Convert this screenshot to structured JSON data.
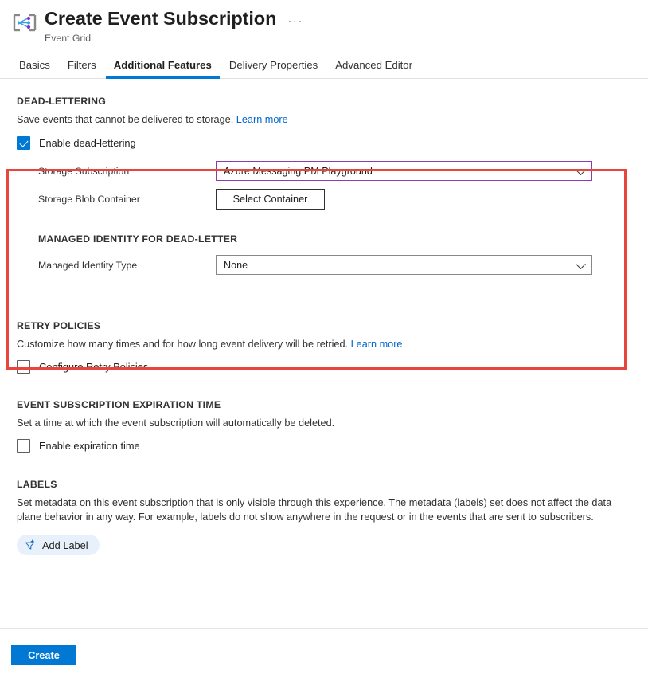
{
  "header": {
    "icon": "event-grid-icon",
    "title": "Create Event Subscription",
    "subtitle": "Event Grid",
    "more_menu": "···"
  },
  "tabs": [
    {
      "label": "Basics",
      "active": false
    },
    {
      "label": "Filters",
      "active": false
    },
    {
      "label": "Additional Features",
      "active": true
    },
    {
      "label": "Delivery Properties",
      "active": false
    },
    {
      "label": "Advanced Editor",
      "active": false
    }
  ],
  "highlight": {
    "color": "#e8453c"
  },
  "dead_lettering": {
    "title": "DEAD-LETTERING",
    "description": "Save events that cannot be delivered to storage.",
    "learn_more": "Learn more",
    "enable_checkbox": {
      "label": "Enable dead-lettering",
      "checked": true
    },
    "storage_subscription": {
      "label": "Storage Subscription",
      "value": "Azure Messaging PM Playground",
      "border_color": "#8e3bb0"
    },
    "storage_blob_container": {
      "label": "Storage Blob Container",
      "button_label": "Select Container"
    },
    "managed_identity": {
      "title": "MANAGED IDENTITY FOR DEAD-LETTER",
      "label": "Managed Identity Type",
      "value": "None"
    }
  },
  "retry_policies": {
    "title": "RETRY POLICIES",
    "description": "Customize how many times and for how long event delivery will be retried.",
    "learn_more": "Learn more",
    "checkbox": {
      "label": "Configure Retry Policies",
      "checked": false
    }
  },
  "expiration": {
    "title": "EVENT SUBSCRIPTION EXPIRATION TIME",
    "description": "Set a time at which the event subscription will automatically be deleted.",
    "checkbox": {
      "label": "Enable expiration time",
      "checked": false
    }
  },
  "labels": {
    "title": "LABELS",
    "description_line1": "Set metadata on this event subscription that is only visible through this experience. The metadata (labels) set does not affect the data plane",
    "description_line2": "behavior in any way. For example, labels do not show anywhere in the request or in the events that are sent to subscribers.",
    "add_button": {
      "label": "Add Label",
      "icon": "add-label-filter-icon"
    }
  },
  "footer": {
    "create_button": "Create",
    "accent_color": "#0078d4"
  }
}
